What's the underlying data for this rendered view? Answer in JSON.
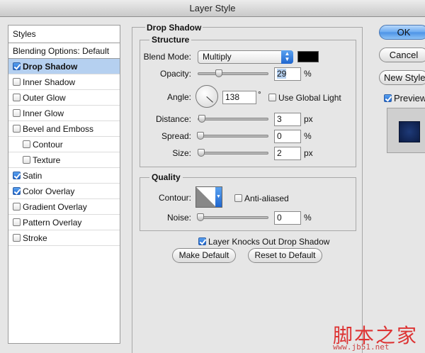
{
  "window": {
    "title": "Layer Style"
  },
  "styles_list": {
    "header": "Styles",
    "blending_options": "Blending Options: Default",
    "items": [
      {
        "label": "Drop Shadow",
        "checked": true,
        "selected": true,
        "sub": false
      },
      {
        "label": "Inner Shadow",
        "checked": false,
        "selected": false,
        "sub": false
      },
      {
        "label": "Outer Glow",
        "checked": false,
        "selected": false,
        "sub": false
      },
      {
        "label": "Inner Glow",
        "checked": false,
        "selected": false,
        "sub": false
      },
      {
        "label": "Bevel and Emboss",
        "checked": false,
        "selected": false,
        "sub": false
      },
      {
        "label": "Contour",
        "checked": false,
        "selected": false,
        "sub": true
      },
      {
        "label": "Texture",
        "checked": false,
        "selected": false,
        "sub": true
      },
      {
        "label": "Satin",
        "checked": true,
        "selected": false,
        "sub": false
      },
      {
        "label": "Color Overlay",
        "checked": true,
        "selected": false,
        "sub": false
      },
      {
        "label": "Gradient Overlay",
        "checked": false,
        "selected": false,
        "sub": false
      },
      {
        "label": "Pattern Overlay",
        "checked": false,
        "selected": false,
        "sub": false
      },
      {
        "label": "Stroke",
        "checked": false,
        "selected": false,
        "sub": false
      }
    ]
  },
  "drop_shadow": {
    "title": "Drop Shadow",
    "structure": {
      "title": "Structure",
      "blend_mode_label": "Blend Mode:",
      "blend_mode_value": "Multiply",
      "shadow_color": "#000000",
      "opacity_label": "Opacity:",
      "opacity_value": "29",
      "opacity_unit": "%",
      "angle_label": "Angle:",
      "angle_value": "138",
      "angle_unit": "°",
      "use_global_light_label": "Use Global Light",
      "distance_label": "Distance:",
      "distance_value": "3",
      "distance_unit": "px",
      "spread_label": "Spread:",
      "spread_value": "0",
      "spread_unit": "%",
      "size_label": "Size:",
      "size_value": "2",
      "size_unit": "px"
    },
    "quality": {
      "title": "Quality",
      "contour_label": "Contour:",
      "anti_aliased_label": "Anti-aliased",
      "noise_label": "Noise:",
      "noise_value": "0",
      "noise_unit": "%"
    },
    "knockout_label": "Layer Knocks Out Drop Shadow",
    "make_default_label": "Make Default",
    "reset_default_label": "Reset to Default"
  },
  "right_buttons": {
    "ok": "OK",
    "cancel": "Cancel",
    "new_style": "New Style...",
    "preview": "Preview"
  },
  "watermark": {
    "cn": "脚本之家",
    "url": "www.jb51.net"
  },
  "colors": {
    "selected_row": "#b5d0f0",
    "accent": "#1f66cf",
    "preview_fill": "#1e3a78"
  }
}
